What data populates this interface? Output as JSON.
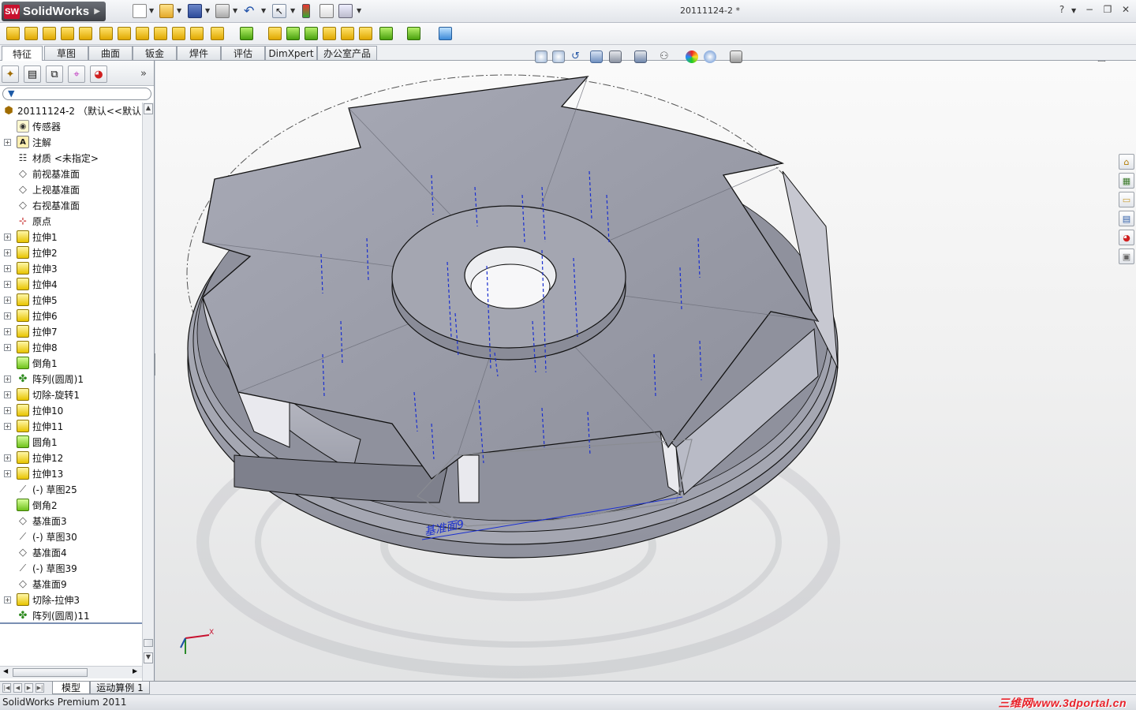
{
  "app": {
    "name": "SolidWorks",
    "badge": "SW",
    "document_title": "20111124-2 *"
  },
  "help_label": "?",
  "command_tabs": [
    "特征",
    "草图",
    "曲面",
    "钣金",
    "焊件",
    "评估",
    "DimXpert",
    "办公室产品"
  ],
  "feature_tree": {
    "root": "20111124-2 （默认<<默认>",
    "items": [
      {
        "label": "传感器",
        "icon": "sensor-icon",
        "expandable": false
      },
      {
        "label": "注解",
        "icon": "annotation-icon",
        "expandable": true
      },
      {
        "label": "材质 <未指定>",
        "icon": "material-icon",
        "expandable": false
      },
      {
        "label": "前视基准面",
        "icon": "plane-icon",
        "expandable": false
      },
      {
        "label": "上视基准面",
        "icon": "plane-icon",
        "expandable": false
      },
      {
        "label": "右视基准面",
        "icon": "plane-icon",
        "expandable": false
      },
      {
        "label": "原点",
        "icon": "origin-icon",
        "expandable": false
      },
      {
        "label": "拉伸1",
        "icon": "extrude-icon",
        "expandable": true
      },
      {
        "label": "拉伸2",
        "icon": "extrude-icon",
        "expandable": true
      },
      {
        "label": "拉伸3",
        "icon": "extrude-icon",
        "expandable": true
      },
      {
        "label": "拉伸4",
        "icon": "extrude-icon",
        "expandable": true
      },
      {
        "label": "拉伸5",
        "icon": "extrude-icon",
        "expandable": true
      },
      {
        "label": "拉伸6",
        "icon": "extrude-icon",
        "expandable": true
      },
      {
        "label": "拉伸7",
        "icon": "extrude-icon",
        "expandable": true
      },
      {
        "label": "拉伸8",
        "icon": "extrude-icon",
        "expandable": true
      },
      {
        "label": "倒角1",
        "icon": "chamfer-icon",
        "expandable": false
      },
      {
        "label": "阵列(圆周)1",
        "icon": "circular-pattern-icon",
        "expandable": true
      },
      {
        "label": "切除-旋转1",
        "icon": "revolve-cut-icon",
        "expandable": true
      },
      {
        "label": "拉伸10",
        "icon": "extrude-icon",
        "expandable": true
      },
      {
        "label": "拉伸11",
        "icon": "extrude-icon",
        "expandable": true
      },
      {
        "label": "圆角1",
        "icon": "fillet-icon",
        "expandable": false
      },
      {
        "label": "拉伸12",
        "icon": "extrude-icon",
        "expandable": true
      },
      {
        "label": "拉伸13",
        "icon": "extrude-icon",
        "expandable": true
      },
      {
        "label": "(-) 草图25",
        "icon": "sketch-icon",
        "expandable": false
      },
      {
        "label": "倒角2",
        "icon": "chamfer-icon",
        "expandable": false
      },
      {
        "label": "基准面3",
        "icon": "plane-icon",
        "expandable": false
      },
      {
        "label": "(-) 草图30",
        "icon": "sketch-icon",
        "expandable": false
      },
      {
        "label": "基准面4",
        "icon": "plane-icon",
        "expandable": false
      },
      {
        "label": "(-) 草图39",
        "icon": "sketch-icon",
        "expandable": false
      },
      {
        "label": "基准面9",
        "icon": "plane-icon",
        "expandable": false
      },
      {
        "label": "切除-拉伸3",
        "icon": "extrude-cut-icon",
        "expandable": true
      },
      {
        "label": "阵列(圆周)11",
        "icon": "circular-pattern-icon",
        "expandable": false
      }
    ]
  },
  "viewport": {
    "plane_label": "基准面9",
    "triad_x_label": "X"
  },
  "bottom_tabs": [
    "模型",
    "运动算例 1"
  ],
  "status": {
    "text": "SolidWorks Premium 2011",
    "watermark": "三维网www.3dportal.cn"
  },
  "colors": {
    "part_face": "#9a9ca8",
    "part_face_light": "#aeb0bb",
    "part_edge": "#1a1a1a",
    "sketch_blue": "#1a2fd0",
    "accent_red": "#c8102e"
  }
}
